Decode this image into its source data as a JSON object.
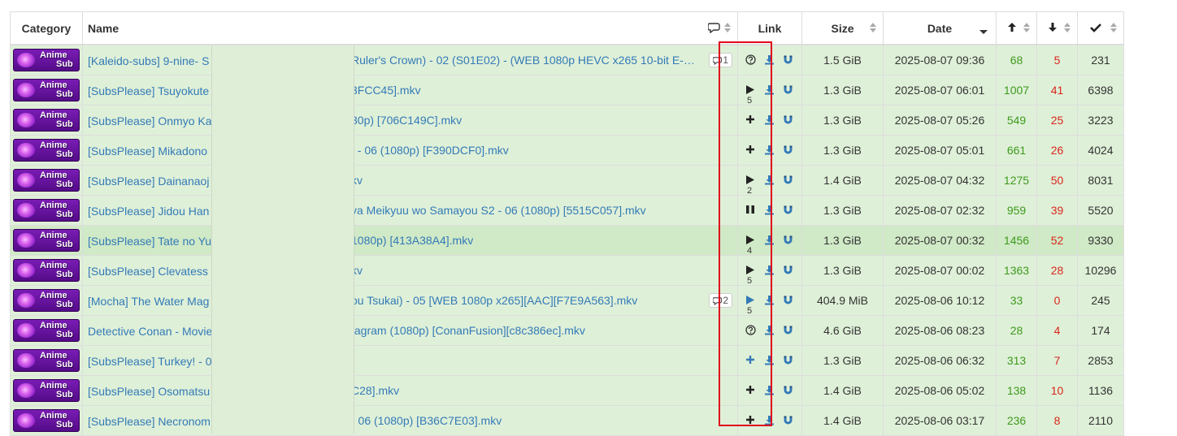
{
  "headers": {
    "category": "Category",
    "name": "Name",
    "link": "Link",
    "size": "Size",
    "date": "Date"
  },
  "category_badge": {
    "line1": "Anime",
    "line2": "Sub"
  },
  "rows": [
    {
      "name": "[Kaleido-subs] 9-nine- S",
      "name_rest": "Ruler's Crown) - 02 (S01E02) - (WEB 1080p HEVC x265 10-bit E-…",
      "comments": "1",
      "action": "help",
      "count": "",
      "size": "1.5 GiB",
      "date": "2025-08-07 09:36",
      "seeders": "68",
      "leechers": "5",
      "completed": "231"
    },
    {
      "name": "[SubsPlease] Tsuyokute",
      "name_rest": "3FCC45].mkv",
      "comments": "",
      "action": "play",
      "count": "5",
      "size": "1.3 GiB",
      "date": "2025-08-07 06:01",
      "seeders": "1007",
      "leechers": "41",
      "completed": "6398"
    },
    {
      "name": "[SubsPlease] Onmyo Ka",
      "name_rest": "30p) [706C149C].mkv",
      "comments": "",
      "action": "plus",
      "count": "",
      "size": "1.3 GiB",
      "date": "2025-08-07 05:26",
      "seeders": "549",
      "leechers": "25",
      "completed": "3223"
    },
    {
      "name": "[SubsPlease] Mikadono",
      "name_rest": ". - 06 (1080p) [F390DCF0].mkv",
      "comments": "",
      "action": "plus",
      "count": "",
      "size": "1.3 GiB",
      "date": "2025-08-07 05:01",
      "seeders": "661",
      "leechers": "26",
      "completed": "4024"
    },
    {
      "name": "[SubsPlease] Dainanaoj",
      "name_rest": "kv",
      "comments": "",
      "action": "play",
      "count": "2",
      "size": "1.4 GiB",
      "date": "2025-08-07 04:32",
      "seeders": "1275",
      "leechers": "50",
      "completed": "8031"
    },
    {
      "name": "[SubsPlease] Jidou Han",
      "name_rest": "va Meikyuu wo Samayou S2 - 06 (1080p) [5515C057].mkv",
      "comments": "",
      "action": "pause",
      "count": "",
      "size": "1.3 GiB",
      "date": "2025-08-07 02:32",
      "seeders": "959",
      "leechers": "39",
      "completed": "5520"
    },
    {
      "name": "[SubsPlease] Tate no Yu",
      "name_rest": "1080p) [413A38A4].mkv",
      "comments": "",
      "action": "play",
      "count": "4",
      "size": "1.3 GiB",
      "date": "2025-08-07 00:32",
      "seeders": "1456",
      "leechers": "52",
      "completed": "9330"
    },
    {
      "name": "[SubsPlease] Clevatess",
      "name_rest": "kv",
      "comments": "",
      "action": "play",
      "count": "5",
      "size": "1.3 GiB",
      "date": "2025-08-07 00:02",
      "seeders": "1363",
      "leechers": "28",
      "completed": "10296"
    },
    {
      "name": "[Mocha] The Water Mag",
      "name_rest": "ou Tsukai) - 05 [WEB 1080p x265][AAC][F7E9A563].mkv",
      "comments": "2",
      "action": "play-blue",
      "count": "5",
      "size": "404.9 MiB",
      "date": "2025-08-06 10:12",
      "seeders": "33",
      "leechers": "0",
      "completed": "245"
    },
    {
      "name": "Detective Conan - Movie",
      "name_rest": "tagram (1080p) [ConanFusion][c8c386ec].mkv",
      "comments": "",
      "action": "help",
      "count": "",
      "size": "4.6 GiB",
      "date": "2025-08-06 08:23",
      "seeders": "28",
      "leechers": "4",
      "completed": "174"
    },
    {
      "name": "[SubsPlease] Turkey! - 0",
      "name_rest": "",
      "comments": "",
      "action": "plus-blue",
      "count": "",
      "size": "1.3 GiB",
      "date": "2025-08-06 06:32",
      "seeders": "313",
      "leechers": "7",
      "completed": "2853"
    },
    {
      "name": "[SubsPlease] Osomatsu",
      "name_rest": "C28].mkv",
      "comments": "",
      "action": "plus",
      "count": "",
      "size": "1.4 GiB",
      "date": "2025-08-06 05:02",
      "seeders": "138",
      "leechers": "10",
      "completed": "1136"
    },
    {
      "name": "[SubsPlease] Necronom",
      "name_rest": "- 06 (1080p) [B36C7E03].mkv",
      "comments": "",
      "action": "plus",
      "count": "",
      "size": "1.4 GiB",
      "date": "2025-08-06 03:17",
      "seeders": "236",
      "leechers": "8",
      "completed": "2110"
    }
  ],
  "icons": {
    "comments_header": "speech-bubble-icon",
    "seeders_header": "arrow-up-icon",
    "leechers_header": "arrow-down-icon",
    "completed_header": "checkmark-icon",
    "download": "download-icon",
    "magnet": "magnet-icon"
  },
  "colors": {
    "row_bg": "#dff0d8",
    "row_highlight": "#d0e9c6",
    "link": "#337ab7",
    "seeders": "#3c9a1c",
    "leechers": "#d9261c",
    "annotation_box": "#e0001a"
  },
  "highlighted_row": 6
}
